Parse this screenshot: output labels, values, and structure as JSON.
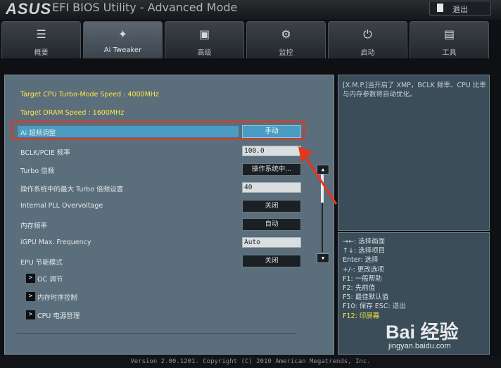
{
  "topbar": {
    "brand": "ASUS",
    "title": "EFI BIOS Utility - Advanced Mode",
    "exit_label": "退出"
  },
  "tabs": [
    {
      "label": "概要",
      "icon": "list-icon",
      "glyph": "☰"
    },
    {
      "label": "Ai Tweaker",
      "icon": "tweaker-icon",
      "glyph": "✦"
    },
    {
      "label": "高级",
      "icon": "chip-icon",
      "glyph": "▣"
    },
    {
      "label": "监控",
      "icon": "monitor-icon",
      "glyph": "⚙"
    },
    {
      "label": "启动",
      "icon": "power-icon",
      "glyph": "⏻"
    },
    {
      "label": "工具",
      "icon": "tool-icon",
      "glyph": "▤"
    }
  ],
  "settings": {
    "target_cpu": "Target CPU Turbo-Mode Speed : 4000MHz",
    "target_dram": "Target DRAM Speed : 1600MHz",
    "ai_oc": {
      "label": "Ai 超频调整",
      "value": "手动"
    },
    "bclk": {
      "label": "BCLK/PCIE 频率",
      "value": "100.0"
    },
    "turbo_ratio": {
      "label": "Turbo 倍频",
      "value": "操作系统中..."
    },
    "max_turbo": {
      "label": "操作系统中的最大 Turbo 倍频设置",
      "value": "40"
    },
    "pll": {
      "label": "Internal PLL Overvoltage",
      "value": "关闭"
    },
    "mem_freq": {
      "label": "内存频率",
      "value": "自动"
    },
    "igpu": {
      "label": "iGPU Max. Frequency",
      "value": "Auto"
    },
    "epu": {
      "label": "EPU 节能模式",
      "value": "关闭"
    },
    "sub_oc": "OC 调节",
    "sub_mem": "内存时序控制",
    "sub_cpu": "CPU 电源管理"
  },
  "help": {
    "text": "[X.M.P.]当开启了 XMP，BCLK 频率、CPU 比率与内存参数将自动优化。",
    "keys": [
      "→←: 选择画面",
      "↑↓: 选择项目",
      "Enter: 选择",
      "+/-: 更改选项",
      "F1: 一般帮助",
      "F2: 先前值",
      "F5: 最佳默认值",
      "F10: 保存  ESC: 退出"
    ],
    "f12": "F12: 印屏幕"
  },
  "footer": {
    "version": "Version 2.00.1201. Copyright (C) 2010 American Megatrends, Inc."
  },
  "watermark": {
    "line1": "Bai 经验",
    "line2": "jingyan.baidu.com"
  },
  "colors": {
    "selection": "#4a9cc2",
    "panel": "#5a6e7b",
    "annotation": "#e8331d",
    "target_text": "#ffe54a"
  }
}
